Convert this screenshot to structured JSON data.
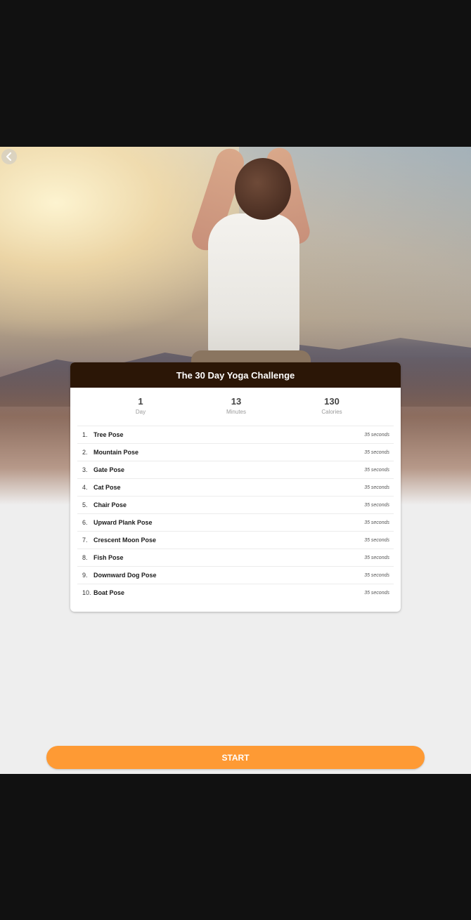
{
  "header": {
    "back_icon": "chevron-left-icon"
  },
  "card": {
    "title": "The 30 Day Yoga Challenge",
    "stats": [
      {
        "value": "1",
        "label": "Day"
      },
      {
        "value": "13",
        "label": "Minutes"
      },
      {
        "value": "130",
        "label": "Calories"
      }
    ],
    "poses": [
      {
        "number": "1.",
        "name": "Tree Pose",
        "duration": "35 seconds"
      },
      {
        "number": "2.",
        "name": "Mountain Pose",
        "duration": "35 seconds"
      },
      {
        "number": "3.",
        "name": "Gate Pose",
        "duration": "35 seconds"
      },
      {
        "number": "4.",
        "name": "Cat Pose",
        "duration": "35 seconds"
      },
      {
        "number": "5.",
        "name": "Chair Pose",
        "duration": "35 seconds"
      },
      {
        "number": "6.",
        "name": "Upward Plank Pose",
        "duration": "35 seconds"
      },
      {
        "number": "7.",
        "name": "Crescent Moon Pose",
        "duration": "35 seconds"
      },
      {
        "number": "8.",
        "name": "Fish Pose",
        "duration": "35 seconds"
      },
      {
        "number": "9.",
        "name": "Downward Dog Pose",
        "duration": "35 seconds"
      },
      {
        "number": "10.",
        "name": "Boat Pose",
        "duration": "35 seconds"
      }
    ]
  },
  "start_button": {
    "label": "START"
  },
  "colors": {
    "accent": "#fe9a34",
    "header_bg": "#2b1606",
    "background": "#eeeeee"
  }
}
